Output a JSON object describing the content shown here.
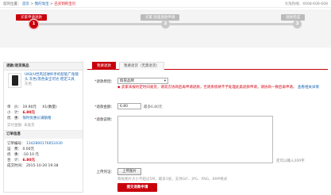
{
  "topbar": {
    "breadcrumb_prefix": "您的位置：",
    "crumbs": [
      "首页",
      "我的淘宝",
      "已买到的宝贝"
    ],
    "separator": " > ",
    "hotline": "大淘热线：4008-608-608"
  },
  "steps": [
    {
      "label": "买家申请退款",
      "number": "1",
      "active": true
    },
    {
      "label": "买家 处理退款申请",
      "number": "2",
      "active": false
    },
    {
      "label": "退款完成",
      "number": "3",
      "active": false
    }
  ],
  "left": {
    "title": "退款/退货商品",
    "product_name": "UK8/U世风冠球杆手机智能广角镜头 灰色/黑色安全可达 稳定工具",
    "product_sub": "灰色",
    "price_label": "单　价：",
    "price": "19.90元",
    "qty": "X1(数量)",
    "subtotal_label": "小　计：",
    "subtotal": "6.80元",
    "service_label": "优　惠：",
    "service_link": "限时优惠价满额赠",
    "shipping_label": "实付金额: 未发货",
    "order_title": "订单信息",
    "order_no_label": "订单编号：",
    "order_no": "1342860176652430",
    "freight_label": "运　费：",
    "freight": "0.00元",
    "discount_label": "优　惠：",
    "discount": "-10.10 元",
    "total_label": "合　计：",
    "total": "6.80元",
    "time_label": "成交时间：",
    "time": "2015-10-20 19:38"
  },
  "form": {
    "tabs": [
      "我要退款",
      "我要退货（无需退货）"
    ],
    "reason_label": "退款原因：",
    "reason_value": "假冒品牌",
    "reason_hint": "卖家未按约定时间发货，请双方协商后再申请退款，否则系统将不予处理此类退款申请，请协商一致后再申请。",
    "reason_hint2": "查看相关详情",
    "amount_label": "退款金额：",
    "amount_value": "6.80",
    "amount_hint": "最多6.80元",
    "desc_label": "退款说明：",
    "desc_counter": "还可以输入200字",
    "upload_label": "上传凭证：",
    "upload_button": "上传图片",
    "upload_hint": "每张图片大小不超过5M，最多3张，支持GIF、JPG、PNG、BMP格式",
    "submit": "提交退款申请"
  }
}
